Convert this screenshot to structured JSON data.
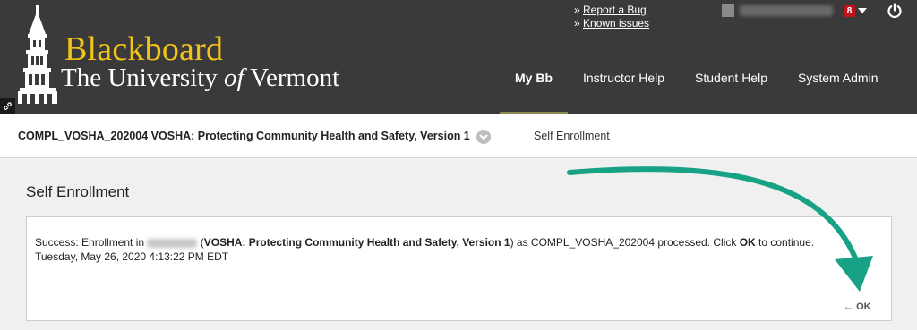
{
  "header": {
    "logo_title": "Blackboard",
    "logo_sub_pre": "The University ",
    "logo_sub_of": "of",
    "logo_sub_post": " Vermont",
    "quick_links": [
      {
        "prefix": "» ",
        "label": "Report a Bug"
      },
      {
        "prefix": "» ",
        "label": "Known issues"
      }
    ],
    "notification_count": "8"
  },
  "nav": {
    "tabs": [
      {
        "label": "My Bb",
        "active": true
      },
      {
        "label": "Instructor Help"
      },
      {
        "label": "Student Help"
      },
      {
        "label": "System Admin"
      }
    ]
  },
  "breadcrumb": {
    "course": "COMPL_VOSHA_202004 VOSHA: Protecting Community Health and Safety, Version 1",
    "current": "Self Enrollment"
  },
  "main": {
    "title": "Self Enrollment",
    "message": {
      "pre": "Success: Enrollment in ",
      "course_bold": "VOSHA: Protecting Community Health and Safety, Version 1",
      "mid": ") as COMPL_VOSHA_202004 processed. Click ",
      "ok_bold": "OK",
      "post": " to continue.",
      "open_paren": " (",
      "timestamp": "Tuesday, May 26, 2020 4:13:22 PM EDT"
    },
    "ok_arrow": "←",
    "ok_label": "OK"
  },
  "colors": {
    "header_bg": "#3a3a3a",
    "logo_gold": "#f2c418",
    "annotation_arrow": "#17a185",
    "badge_red": "#c0141a"
  }
}
